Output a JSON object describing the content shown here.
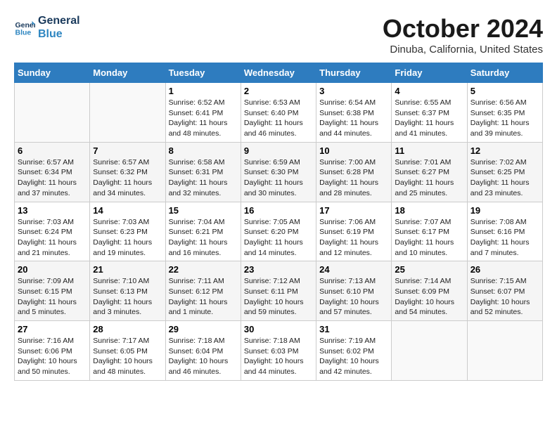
{
  "header": {
    "logo_line1": "General",
    "logo_line2": "Blue",
    "month_title": "October 2024",
    "location": "Dinuba, California, United States"
  },
  "weekdays": [
    "Sunday",
    "Monday",
    "Tuesday",
    "Wednesday",
    "Thursday",
    "Friday",
    "Saturday"
  ],
  "weeks": [
    [
      {
        "day": "",
        "content": ""
      },
      {
        "day": "",
        "content": ""
      },
      {
        "day": "1",
        "content": "Sunrise: 6:52 AM\nSunset: 6:41 PM\nDaylight: 11 hours and 48 minutes."
      },
      {
        "day": "2",
        "content": "Sunrise: 6:53 AM\nSunset: 6:40 PM\nDaylight: 11 hours and 46 minutes."
      },
      {
        "day": "3",
        "content": "Sunrise: 6:54 AM\nSunset: 6:38 PM\nDaylight: 11 hours and 44 minutes."
      },
      {
        "day": "4",
        "content": "Sunrise: 6:55 AM\nSunset: 6:37 PM\nDaylight: 11 hours and 41 minutes."
      },
      {
        "day": "5",
        "content": "Sunrise: 6:56 AM\nSunset: 6:35 PM\nDaylight: 11 hours and 39 minutes."
      }
    ],
    [
      {
        "day": "6",
        "content": "Sunrise: 6:57 AM\nSunset: 6:34 PM\nDaylight: 11 hours and 37 minutes."
      },
      {
        "day": "7",
        "content": "Sunrise: 6:57 AM\nSunset: 6:32 PM\nDaylight: 11 hours and 34 minutes."
      },
      {
        "day": "8",
        "content": "Sunrise: 6:58 AM\nSunset: 6:31 PM\nDaylight: 11 hours and 32 minutes."
      },
      {
        "day": "9",
        "content": "Sunrise: 6:59 AM\nSunset: 6:30 PM\nDaylight: 11 hours and 30 minutes."
      },
      {
        "day": "10",
        "content": "Sunrise: 7:00 AM\nSunset: 6:28 PM\nDaylight: 11 hours and 28 minutes."
      },
      {
        "day": "11",
        "content": "Sunrise: 7:01 AM\nSunset: 6:27 PM\nDaylight: 11 hours and 25 minutes."
      },
      {
        "day": "12",
        "content": "Sunrise: 7:02 AM\nSunset: 6:25 PM\nDaylight: 11 hours and 23 minutes."
      }
    ],
    [
      {
        "day": "13",
        "content": "Sunrise: 7:03 AM\nSunset: 6:24 PM\nDaylight: 11 hours and 21 minutes."
      },
      {
        "day": "14",
        "content": "Sunrise: 7:03 AM\nSunset: 6:23 PM\nDaylight: 11 hours and 19 minutes."
      },
      {
        "day": "15",
        "content": "Sunrise: 7:04 AM\nSunset: 6:21 PM\nDaylight: 11 hours and 16 minutes."
      },
      {
        "day": "16",
        "content": "Sunrise: 7:05 AM\nSunset: 6:20 PM\nDaylight: 11 hours and 14 minutes."
      },
      {
        "day": "17",
        "content": "Sunrise: 7:06 AM\nSunset: 6:19 PM\nDaylight: 11 hours and 12 minutes."
      },
      {
        "day": "18",
        "content": "Sunrise: 7:07 AM\nSunset: 6:17 PM\nDaylight: 11 hours and 10 minutes."
      },
      {
        "day": "19",
        "content": "Sunrise: 7:08 AM\nSunset: 6:16 PM\nDaylight: 11 hours and 7 minutes."
      }
    ],
    [
      {
        "day": "20",
        "content": "Sunrise: 7:09 AM\nSunset: 6:15 PM\nDaylight: 11 hours and 5 minutes."
      },
      {
        "day": "21",
        "content": "Sunrise: 7:10 AM\nSunset: 6:13 PM\nDaylight: 11 hours and 3 minutes."
      },
      {
        "day": "22",
        "content": "Sunrise: 7:11 AM\nSunset: 6:12 PM\nDaylight: 11 hours and 1 minute."
      },
      {
        "day": "23",
        "content": "Sunrise: 7:12 AM\nSunset: 6:11 PM\nDaylight: 10 hours and 59 minutes."
      },
      {
        "day": "24",
        "content": "Sunrise: 7:13 AM\nSunset: 6:10 PM\nDaylight: 10 hours and 57 minutes."
      },
      {
        "day": "25",
        "content": "Sunrise: 7:14 AM\nSunset: 6:09 PM\nDaylight: 10 hours and 54 minutes."
      },
      {
        "day": "26",
        "content": "Sunrise: 7:15 AM\nSunset: 6:07 PM\nDaylight: 10 hours and 52 minutes."
      }
    ],
    [
      {
        "day": "27",
        "content": "Sunrise: 7:16 AM\nSunset: 6:06 PM\nDaylight: 10 hours and 50 minutes."
      },
      {
        "day": "28",
        "content": "Sunrise: 7:17 AM\nSunset: 6:05 PM\nDaylight: 10 hours and 48 minutes."
      },
      {
        "day": "29",
        "content": "Sunrise: 7:18 AM\nSunset: 6:04 PM\nDaylight: 10 hours and 46 minutes."
      },
      {
        "day": "30",
        "content": "Sunrise: 7:18 AM\nSunset: 6:03 PM\nDaylight: 10 hours and 44 minutes."
      },
      {
        "day": "31",
        "content": "Sunrise: 7:19 AM\nSunset: 6:02 PM\nDaylight: 10 hours and 42 minutes."
      },
      {
        "day": "",
        "content": ""
      },
      {
        "day": "",
        "content": ""
      }
    ]
  ]
}
